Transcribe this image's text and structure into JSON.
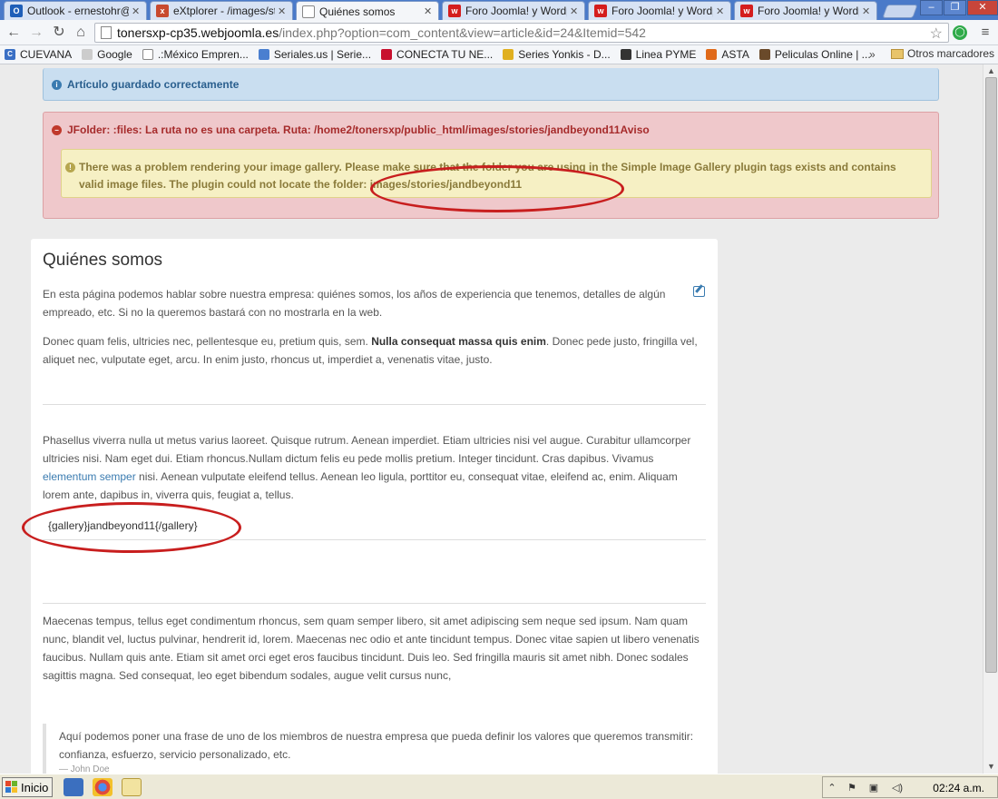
{
  "browser": {
    "tabs": [
      {
        "title": "Outlook - ernestohr@",
        "icon": "outlook-icon",
        "color": "#1f5fb8",
        "glyph": "O"
      },
      {
        "title": "eXtplorer - /images/st",
        "icon": "extplorer-icon",
        "color": "#c84a2f",
        "glyph": "x"
      },
      {
        "title": "Quiénes somos",
        "icon": "page-icon",
        "color": "#ffffff",
        "glyph": ""
      },
      {
        "title": "Foro Joomla! y Wordp",
        "icon": "forum-icon",
        "color": "#d41d1d",
        "glyph": "w"
      },
      {
        "title": "Foro Joomla! y Wordp",
        "icon": "forum-icon",
        "color": "#d41d1d",
        "glyph": "w"
      },
      {
        "title": "Foro Joomla! y Wordp",
        "icon": "forum-icon",
        "color": "#d41d1d",
        "glyph": "w"
      }
    ],
    "active_tab": 2,
    "url_host": "tonersxp-cp35.webjoomla.es",
    "url_path": "/index.php?option=com_content&view=article&id=24&Itemid=542",
    "bookmarks": [
      {
        "label": "CUEVANA",
        "color": "#3a6fc4",
        "glyph": "C"
      },
      {
        "label": "Google",
        "color": "#cccccc",
        "glyph": ""
      },
      {
        "label": ".:México Empren...",
        "color": "#ffffff",
        "glyph": ""
      },
      {
        "label": "Seriales.us | Serie...",
        "color": "#4a7fd0",
        "glyph": ""
      },
      {
        "label": "CONECTA TU NE...",
        "color": "#c8102e",
        "glyph": ""
      },
      {
        "label": "Series Yonkis - D...",
        "color": "#e0b020",
        "glyph": ""
      },
      {
        "label": "Linea PYME",
        "color": "#333333",
        "glyph": ""
      },
      {
        "label": "ASTA",
        "color": "#e06a1a",
        "glyph": ""
      },
      {
        "label": "Peliculas Online | ...",
        "color": "#6a4a2a",
        "glyph": ""
      }
    ],
    "bookmarks_more": "»",
    "other_bookmarks": "Otros marcadores"
  },
  "alerts": {
    "success": "Artículo guardado correctamente",
    "error": "JFolder: :files: La ruta no es una carpeta. Ruta: /home2/tonersxp/public_html/images/stories/jandbeyond11Aviso",
    "warning": "There was a problem rendering your image gallery. Please make sure that the folder you are using in the Simple Image Gallery plugin tags exists and contains valid image files. The plugin could not locate the folder: images/stories/jandbeyond11"
  },
  "article": {
    "title": "Quiénes somos",
    "intro": "En esta página podemos hablar sobre nuestra empresa: quiénes somos, los años de experiencia que tenemos, detalles de algún empreado, etc. Si no la queremos bastará con no mostrarla en la web.",
    "para2_a": "Donec quam felis, ultricies nec, pellentesque eu, pretium quis, sem. ",
    "para2_bold": "Nulla consequat massa quis enim",
    "para2_b": ". Donec pede justo, fringilla vel, aliquet nec, vulputate eget, arcu. In enim justo, rhoncus ut, imperdiet a, venenatis vitae, justo.",
    "para3_a": "Phasellus viverra nulla ut metus varius laoreet. Quisque rutrum. Aenean imperdiet. Etiam ultricies nisi vel augue. Curabitur ullamcorper ultricies nisi. Nam eget dui. Etiam rhoncus.Nullam dictum felis eu pede mollis pretium. Integer tincidunt. Cras dapibus. Vivamus ",
    "para3_link": "elementum semper",
    "para3_b": " nisi. Aenean vulputate eleifend tellus. Aenean leo ligula, porttitor eu, consequat vitae, eleifend ac, enim. Aliquam lorem ante, dapibus in, viverra quis, feugiat a, tellus.",
    "gallery_tag": "{gallery}jandbeyond11{/gallery}",
    "para4": "Maecenas tempus, tellus eget condimentum rhoncus, sem quam semper libero, sit amet adipiscing sem neque sed ipsum. Nam quam nunc, blandit vel, luctus pulvinar, hendrerit id, lorem. Maecenas nec odio et ante tincidunt tempus. Donec vitae sapien ut libero venenatis faucibus. Nullam quis ante. Etiam sit amet orci eget eros faucibus tincidunt. Duis leo. Sed fringilla mauris sit amet nibh. Donec sodales sagittis magna. Sed consequat, leo eget bibendum sodales, augue velit cursus nunc,",
    "quote": "Aquí podemos poner una frase de uno de los miembros de nuestra empresa que pueda definir los valores que queremos transmitir: confianza, esfuerzo, servicio personalizado, etc.",
    "quote_author": "— John Doe"
  },
  "taskbar": {
    "start_label": "Inicio",
    "clock": "02:24 a.m."
  },
  "colors": {
    "annotation": "#c81e1e",
    "link": "#3a7bb0"
  }
}
